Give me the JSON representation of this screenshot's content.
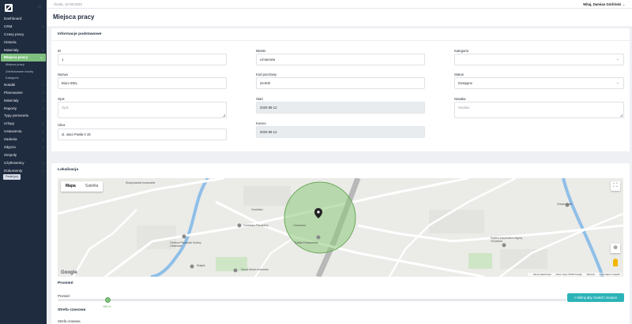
{
  "sidebar": {
    "items": [
      {
        "label": "Dashboard",
        "arrow": ""
      },
      {
        "label": "CRM",
        "arrow": "›"
      },
      {
        "label": "Czasy pracy",
        "arrow": ""
      },
      {
        "label": "Historia",
        "arrow": ""
      },
      {
        "label": "Materiały",
        "arrow": "›"
      }
    ],
    "active": {
      "label": "Miejsca pracy",
      "arrow": "⌄"
    },
    "subitems": [
      "Miejsca pracy",
      "Zdefiniowane koszty",
      "Kategorie"
    ],
    "items2": [
      {
        "label": "Notatki",
        "arrow": "›"
      },
      {
        "label": "Planowanie",
        "arrow": "›"
      },
      {
        "label": "Materiały",
        "arrow": "›"
      },
      {
        "label": "Raporty",
        "arrow": "›"
      },
      {
        "label": "Typy personelu",
        "arrow": ""
      },
      {
        "label": "Urlopy",
        "arrow": "›"
      },
      {
        "label": "Ustawienia",
        "arrow": "›"
      },
      {
        "label": "Zadania",
        "arrow": "›"
      },
      {
        "label": "Zdjęcia",
        "arrow": "›"
      },
      {
        "label": "Zespoły",
        "arrow": ""
      },
      {
        "label": "Użytkownicy",
        "arrow": "›"
      },
      {
        "label": "Dokumenty",
        "arrow": "›"
      }
    ],
    "small_button": "Posłał (po)"
  },
  "topbar": {
    "date": "Środa, 12-08-2020",
    "user": "Witaj, Damian Górliński",
    "caret": "⌄"
  },
  "page": {
    "title": "Miejsca pracy"
  },
  "info": {
    "title": "Informacje podstawowe",
    "id_label": "ID",
    "id_value": "1",
    "nazwa_label": "Nazwa",
    "nazwa_value": "Biuro IDEL",
    "opis_label": "Opis",
    "opis_placeholder": "Opis",
    "ulica_label": "Ulica",
    "ulica_value": "ul. Jana Pawła II 18",
    "miasto_label": "Miasto",
    "miasto_value": "Limanowa",
    "kod_label": "Kod pocztowy",
    "kod_value": "34-600",
    "start_label": "Start",
    "start_value": "2020-08-12",
    "koniec_label": "Koniec",
    "koniec_value": "2020-08-12",
    "kategoria_label": "Kategoria",
    "kategoria_value": "",
    "status_label": "Status",
    "status_value": "Dostępne",
    "notatka_label": "Notatka",
    "notatka_placeholder": "Notatka",
    "dropdown_glyph": "⌄"
  },
  "location": {
    "title": "Lokalizacja",
    "map_tab_map": "Mapa",
    "map_tab_sat": "Satelita",
    "fullscreen_glyph": "⛶",
    "locate_glyph": "⊕",
    "google": "Google",
    "footer": [
      "Skróty klawiszowe",
      "Dane mapy ©2020 Google",
      "Warunki",
      "Zgłoś błąd w mapach"
    ],
    "labels": [
      "Limanowa",
      "Cmentarz Parafialny",
      "Centrum Pływackie Kultury Limanowa",
      "Szkoła Podstawowa",
      "Sklepik",
      "Sanok Arkad Limanowa",
      "Kaplica przydrożna z figurą Chrystusa",
      "Classic Hotel",
      "Grodzisko",
      "Skrzyżowanie komunalne"
    ],
    "radius_section": "Promień",
    "radius_label": "Promień",
    "radius_value": "150 m",
    "radius_fraction": 0.1,
    "find_button": "Kliknij aby znaleźć miejsce",
    "tz_section": "Strefa czasowa",
    "tz_label": "Strefa czasowa"
  },
  "colors": {
    "accent": "#7fbf7f",
    "sidebar": "#1f2b3e",
    "button": "#2bb3b8",
    "circle": "#8cc97a"
  }
}
